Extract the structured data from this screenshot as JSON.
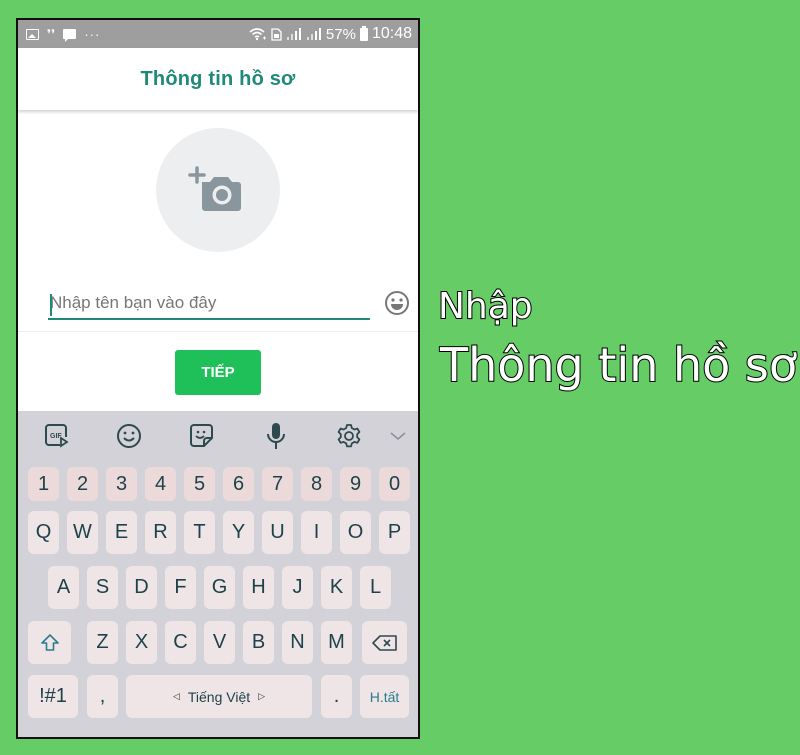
{
  "status_bar": {
    "left_icons": [
      "gallery-icon",
      "footsteps-icon",
      "chat-icon",
      "more-dots-icon"
    ],
    "more_dots": "···",
    "battery_percent": "57%",
    "time": "10:48"
  },
  "header": {
    "title": "Thông tin hồ sơ"
  },
  "profile": {
    "photo_icon": "add-camera-icon",
    "name_placeholder": "Nhập tên bạn vào đây",
    "name_value": "",
    "next_label": "TIẾP"
  },
  "keyboard": {
    "toolbar": [
      "gif-icon",
      "emoji-icon",
      "sticker-icon",
      "mic-icon",
      "settings-icon",
      "collapse-chevron-icon"
    ],
    "gif_label": "GIF",
    "number_row": [
      "1",
      "2",
      "3",
      "4",
      "5",
      "6",
      "7",
      "8",
      "9",
      "0"
    ],
    "row1": [
      "Q",
      "W",
      "E",
      "R",
      "T",
      "Y",
      "U",
      "I",
      "O",
      "P"
    ],
    "row2": [
      "A",
      "S",
      "D",
      "F",
      "G",
      "H",
      "J",
      "K",
      "L"
    ],
    "row3": [
      "Z",
      "X",
      "C",
      "V",
      "B",
      "N",
      "M"
    ],
    "symbols_label": "!#1",
    "comma_label": ",",
    "space_label": "Tiếng Việt",
    "period_label": ".",
    "done_label": "H.tất"
  },
  "caption": {
    "line1": "Nhập",
    "line2": "Thông tin hồ sơ"
  },
  "colors": {
    "background": "#66cc66",
    "accent": "#1f8a78",
    "next_button": "#1fc05a",
    "keyboard_bg": "#d3d2d8",
    "key_bg": "#efe5e6",
    "number_key_bg": "#ecd9da"
  }
}
